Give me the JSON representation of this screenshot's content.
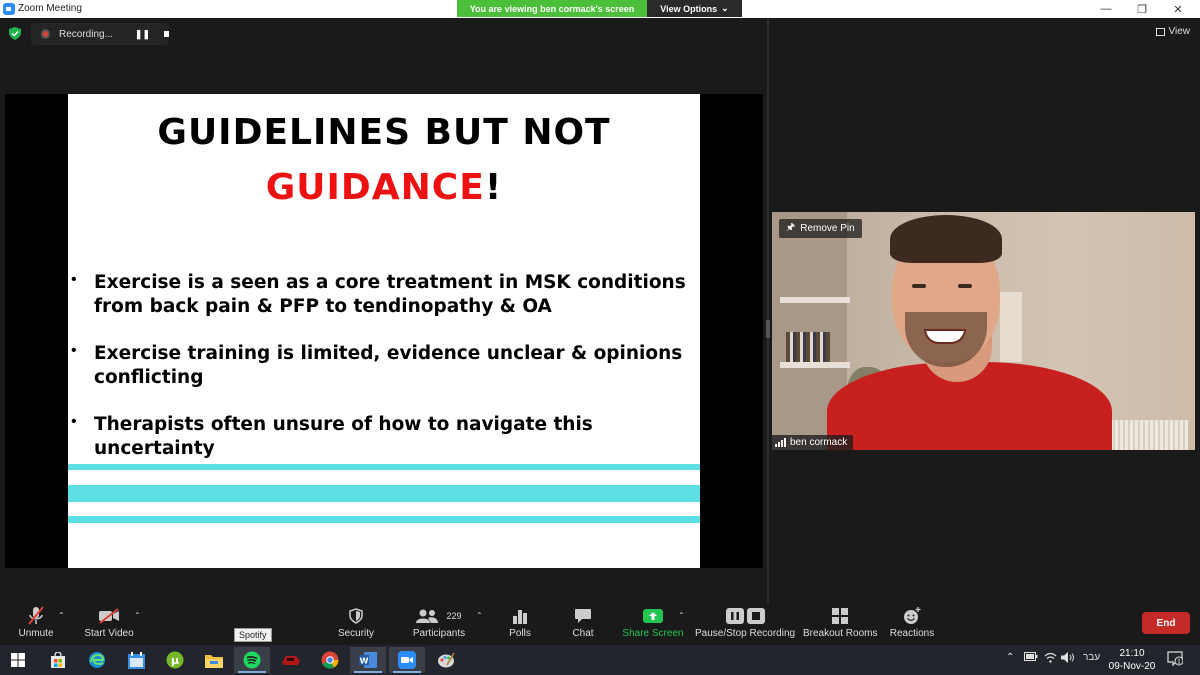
{
  "window": {
    "title": "Zoom Meeting",
    "minimize_icon": "minimize-icon",
    "maximize_icon": "restore-icon",
    "close_icon": "close-icon"
  },
  "banner": {
    "message": "You are viewing ben cormack's screen",
    "options_label": "View Options"
  },
  "top_bar": {
    "recording_label": "Recording...",
    "view_label": "View"
  },
  "slide": {
    "title_line1": "GUIDELINES BUT NOT",
    "title_line2_red": "GUIDANCE",
    "title_line2_suffix": "!",
    "bullets": [
      "Exercise is a seen as a core treatment in MSK conditions from back pain & PFP to tendinopathy & OA",
      "Exercise training is limited, evidence unclear & opinions conflicting",
      "Therapists often unsure of how to navigate this uncertainty"
    ],
    "stripe_color": "#5ce0e6",
    "accent_color": "#ee1111"
  },
  "video": {
    "remove_pin_label": "Remove Pin",
    "participant_name": "ben cormack"
  },
  "controls": {
    "unmute": "Unmute",
    "start_video": "Start Video",
    "security": "Security",
    "participants": "Participants",
    "participant_count": "229",
    "polls": "Polls",
    "chat": "Chat",
    "share_screen": "Share Screen",
    "pause_stop_recording": "Pause/Stop Recording",
    "breakout_rooms": "Breakout Rooms",
    "reactions": "Reactions",
    "end": "End",
    "share_color": "#23c552",
    "end_color": "#c42a26"
  },
  "taskbar": {
    "tooltip": "Spotify",
    "language": "עבר",
    "time": "21:10",
    "date": "09-Nov-20",
    "notification_count": "1"
  }
}
